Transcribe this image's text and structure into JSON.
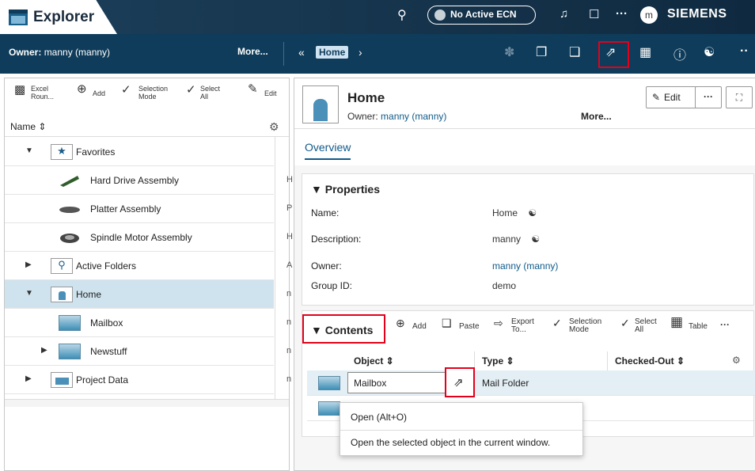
{
  "app": {
    "title": "Explorer",
    "brand": "SIEMENS",
    "ecn": "No Active ECN",
    "avatar": "m"
  },
  "nav": {
    "owner_label": "Owner:",
    "owner_value": "manny (manny)",
    "more": "More...",
    "breadcrumb": "Home"
  },
  "left_toolbar": {
    "excel": "Excel Roun...",
    "add": "Add",
    "selection": "Selection Mode",
    "select_all": "Select All",
    "edit": "Edit"
  },
  "tree": {
    "header": "Name",
    "rows": [
      {
        "label": "Favorites"
      },
      {
        "label": "Hard Drive Assembly",
        "cut": "H"
      },
      {
        "label": "Platter Assembly",
        "cut": "P"
      },
      {
        "label": "Spindle Motor Assembly",
        "cut": "H"
      },
      {
        "label": "Active Folders",
        "cut": "A"
      },
      {
        "label": "Home",
        "cut": "n"
      },
      {
        "label": "Mailbox",
        "cut": "n"
      },
      {
        "label": "Newstuff",
        "cut": "n"
      },
      {
        "label": "Project Data",
        "cut": "n"
      }
    ]
  },
  "detail": {
    "title": "Home",
    "owner_label": "Owner:",
    "owner_value": "manny (manny)",
    "more": "More...",
    "edit": "Edit",
    "tab": "Overview"
  },
  "properties": {
    "heading": "Properties",
    "items": [
      {
        "key": "Name:",
        "value": "Home"
      },
      {
        "key": "Description:",
        "value": "manny"
      },
      {
        "key": "Owner:",
        "value": "manny (manny)"
      },
      {
        "key": "Group ID:",
        "value": "demo"
      }
    ]
  },
  "contents": {
    "heading": "Contents",
    "add": "Add",
    "paste": "Paste",
    "export": "Export To...",
    "selection": "Selection Mode",
    "select_all": "Select All",
    "table": "Table",
    "columns": [
      "Object",
      "Type",
      "Checked-Out"
    ],
    "rows": [
      {
        "object": "Mailbox",
        "type": "Mail Folder"
      },
      {
        "object": "",
        "type": ""
      }
    ]
  },
  "tooltip": {
    "title": "Open (Alt+O)",
    "text": "Open the selected object in the current window."
  },
  "colors": {
    "topbar": "#1d3f5a",
    "navbar": "#0f3c5a",
    "highlight": "#e3001b",
    "selected_row": "#cfe3ee"
  }
}
